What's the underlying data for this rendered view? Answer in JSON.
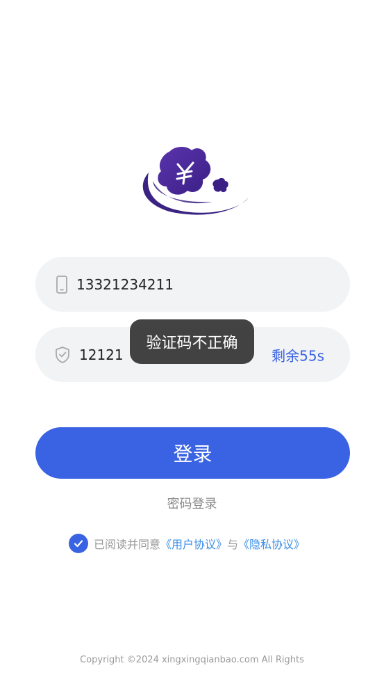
{
  "phone": {
    "value": "13321234211",
    "icon": "mobile-phone-icon"
  },
  "code": {
    "value": "12121",
    "icon": "shield-check-icon",
    "countdown": "剩余55s"
  },
  "toast": {
    "message": "验证码不正确"
  },
  "login_button": {
    "label": "登录"
  },
  "password_login": {
    "label": "密码登录"
  },
  "agreement": {
    "prefix": "已阅读并同意",
    "user_agreement": "《用户协议》",
    "conjunction": "与",
    "privacy_policy": "《隐私协议》",
    "checked": true
  },
  "footer": {
    "copyright": "Copyright ©2024 xingxingqianbao.com All Rights"
  },
  "colors": {
    "primary": "#3a63e4",
    "link": "#3a8ee6",
    "logo_purple": "#4a2a94"
  }
}
